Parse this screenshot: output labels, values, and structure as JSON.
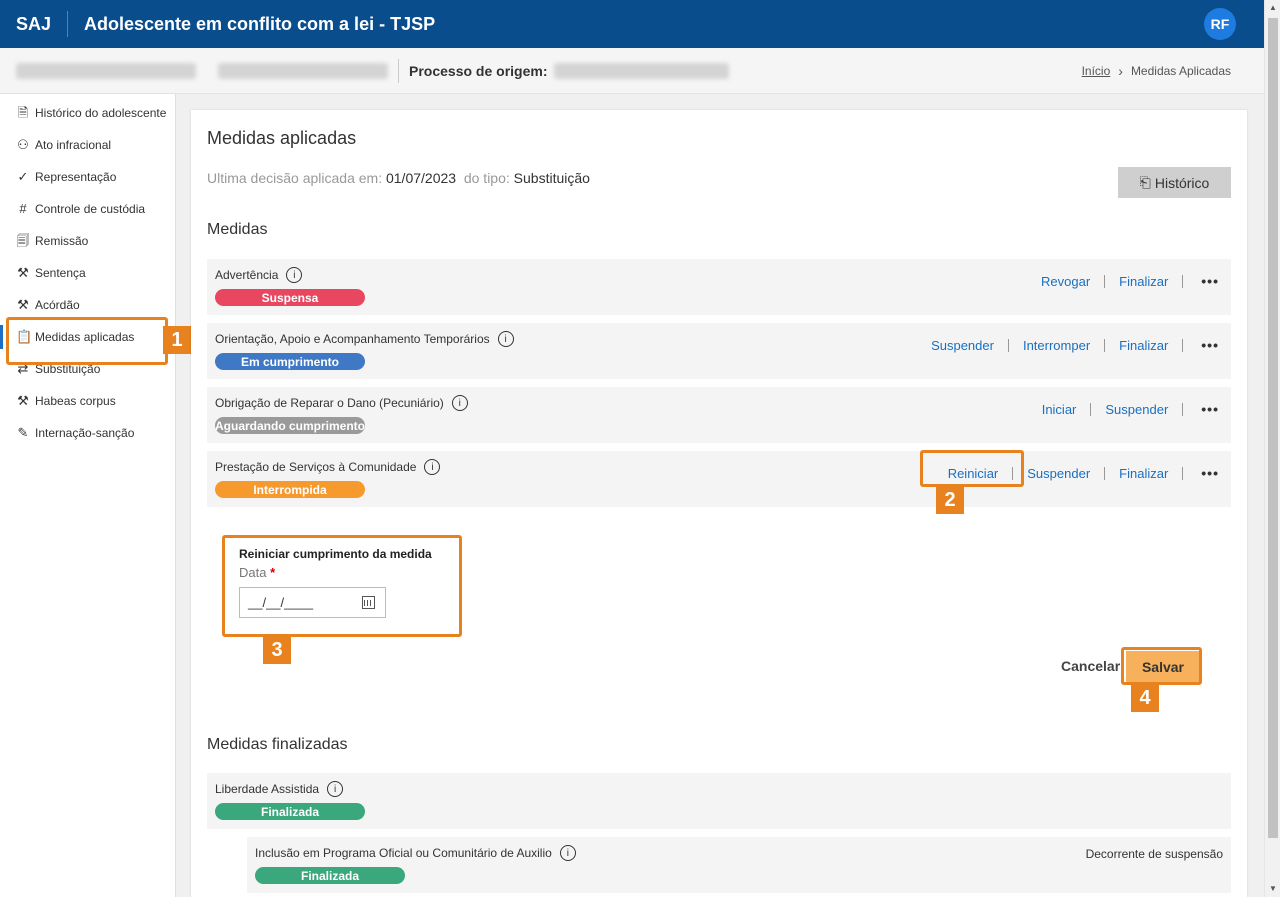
{
  "header": {
    "brand": "SAJ",
    "title": "Adolescente em conflito com a lei - TJSP",
    "avatar": "RF"
  },
  "subheader": {
    "origin_label": "Processo de origem:",
    "breadcrumb": {
      "home": "Início",
      "current": "Medidas Aplicadas"
    }
  },
  "sidebar": {
    "items": [
      {
        "label": "Histórico do adolescente",
        "icon": "document-icon"
      },
      {
        "label": "Ato infracional",
        "icon": "person-icon"
      },
      {
        "label": "Representação",
        "icon": "check-icon"
      },
      {
        "label": "Controle de custódia",
        "icon": "grid-hash-icon"
      },
      {
        "label": "Remissão",
        "icon": "document-search-icon"
      },
      {
        "label": "Sentença",
        "icon": "gavel-icon"
      },
      {
        "label": "Acórdão",
        "icon": "gavel-icon"
      },
      {
        "label": "Medidas aplicadas",
        "icon": "clipboard-icon",
        "active": true
      },
      {
        "label": "Substituição",
        "icon": "swap-icon"
      },
      {
        "label": "Habeas corpus",
        "icon": "gavel-icon"
      },
      {
        "label": "Internação-sanção",
        "icon": "edit-document-icon"
      }
    ]
  },
  "main": {
    "title": "Medidas aplicadas",
    "decision_label": "Ultima decisão aplicada em:",
    "decision_date": "01/07/2023",
    "decision_type_label": "do tipo:",
    "decision_type": "Substituição",
    "history_button": "Histórico",
    "measures_title": "Medidas",
    "measures": [
      {
        "name": "Advertência",
        "status": "Suspensa",
        "status_color": "#e8475f",
        "actions": [
          "Revogar",
          "Finalizar"
        ]
      },
      {
        "name": "Orientação, Apoio e Acompanhamento Temporários",
        "status": "Em cumprimento",
        "status_color": "#3f78c4",
        "actions": [
          "Suspender",
          "Interromper",
          "Finalizar"
        ]
      },
      {
        "name": "Obrigação de Reparar o Dano (Pecuniário)",
        "status": "Aguardando cumprimento",
        "status_color": "#9a9a9a",
        "actions": [
          "Iniciar",
          "Suspender"
        ]
      },
      {
        "name": "Prestação de Serviços à Comunidade",
        "status": "Interrompida",
        "status_color": "#f79a2e",
        "actions": [
          "Reiniciar",
          "Suspender",
          "Finalizar"
        ]
      }
    ],
    "more_label": "•••",
    "form": {
      "title": "Reiniciar cumprimento da medida",
      "date_label": "Data",
      "required_mark": "*",
      "date_placeholder": "__/__/____",
      "cancel": "Cancelar",
      "save": "Salvar"
    },
    "finished_title": "Medidas finalizadas",
    "finished": [
      {
        "name": "Liberdade Assistida",
        "status": "Finalizada",
        "status_color": "#3aa77d"
      },
      {
        "name": "Inclusão em Programa Oficial ou Comunitário de Auxilio",
        "status": "Finalizada",
        "status_color": "#3aa77d",
        "note": "Decorrente de suspensão"
      }
    ]
  },
  "annotations": [
    "1",
    "2",
    "3",
    "4"
  ],
  "colors": {
    "header": "#0a4d8c",
    "link": "#1a6fc0",
    "annotation": "#e8821e"
  }
}
